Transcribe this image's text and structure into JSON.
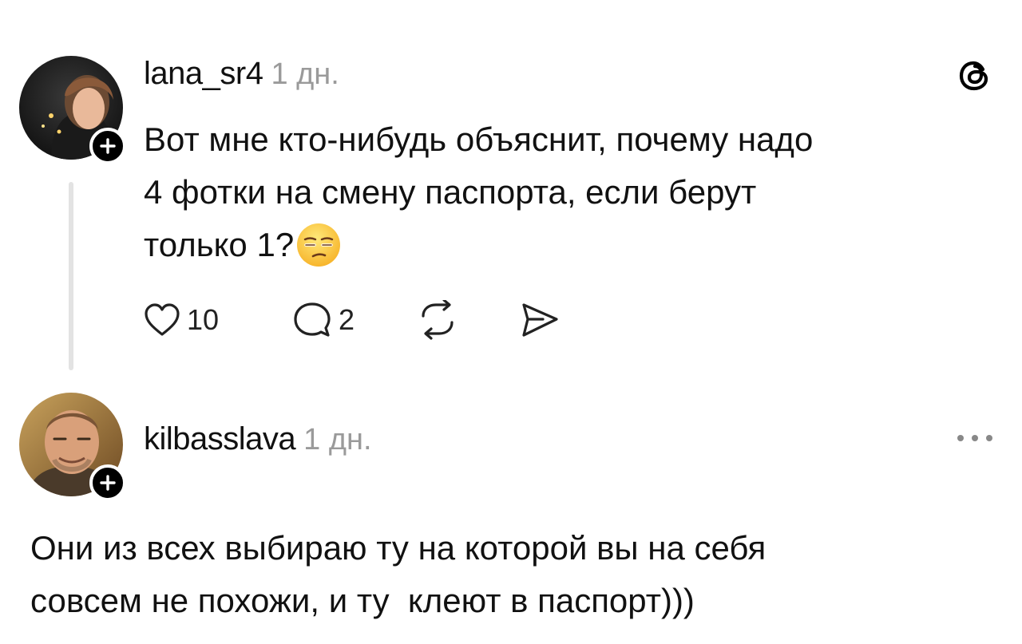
{
  "post": {
    "username": "lana_sr4",
    "time": "1 дн.",
    "text_line1": "Вот мне кто-нибудь объяснит, почему надо",
    "text_line2": "4 фотки на смену паспорта, если берут",
    "text_line3": "только 1?",
    "emoji": "unamused-face-emoji",
    "likes": "10",
    "replies": "2"
  },
  "reply": {
    "username": "kilbasslava",
    "time": "1 дн.",
    "text_line1": "Они из всех выбираю ту на которой вы на себя",
    "text_line2": "совсем не похожи, и ту  клеют в паспорт)))"
  },
  "icons": {
    "threads_logo": "threads-logo-icon",
    "heart": "heart-icon",
    "comment": "comment-icon",
    "repost": "repost-icon",
    "share": "share-icon",
    "more": "more-icon",
    "follow": "plus-icon"
  }
}
